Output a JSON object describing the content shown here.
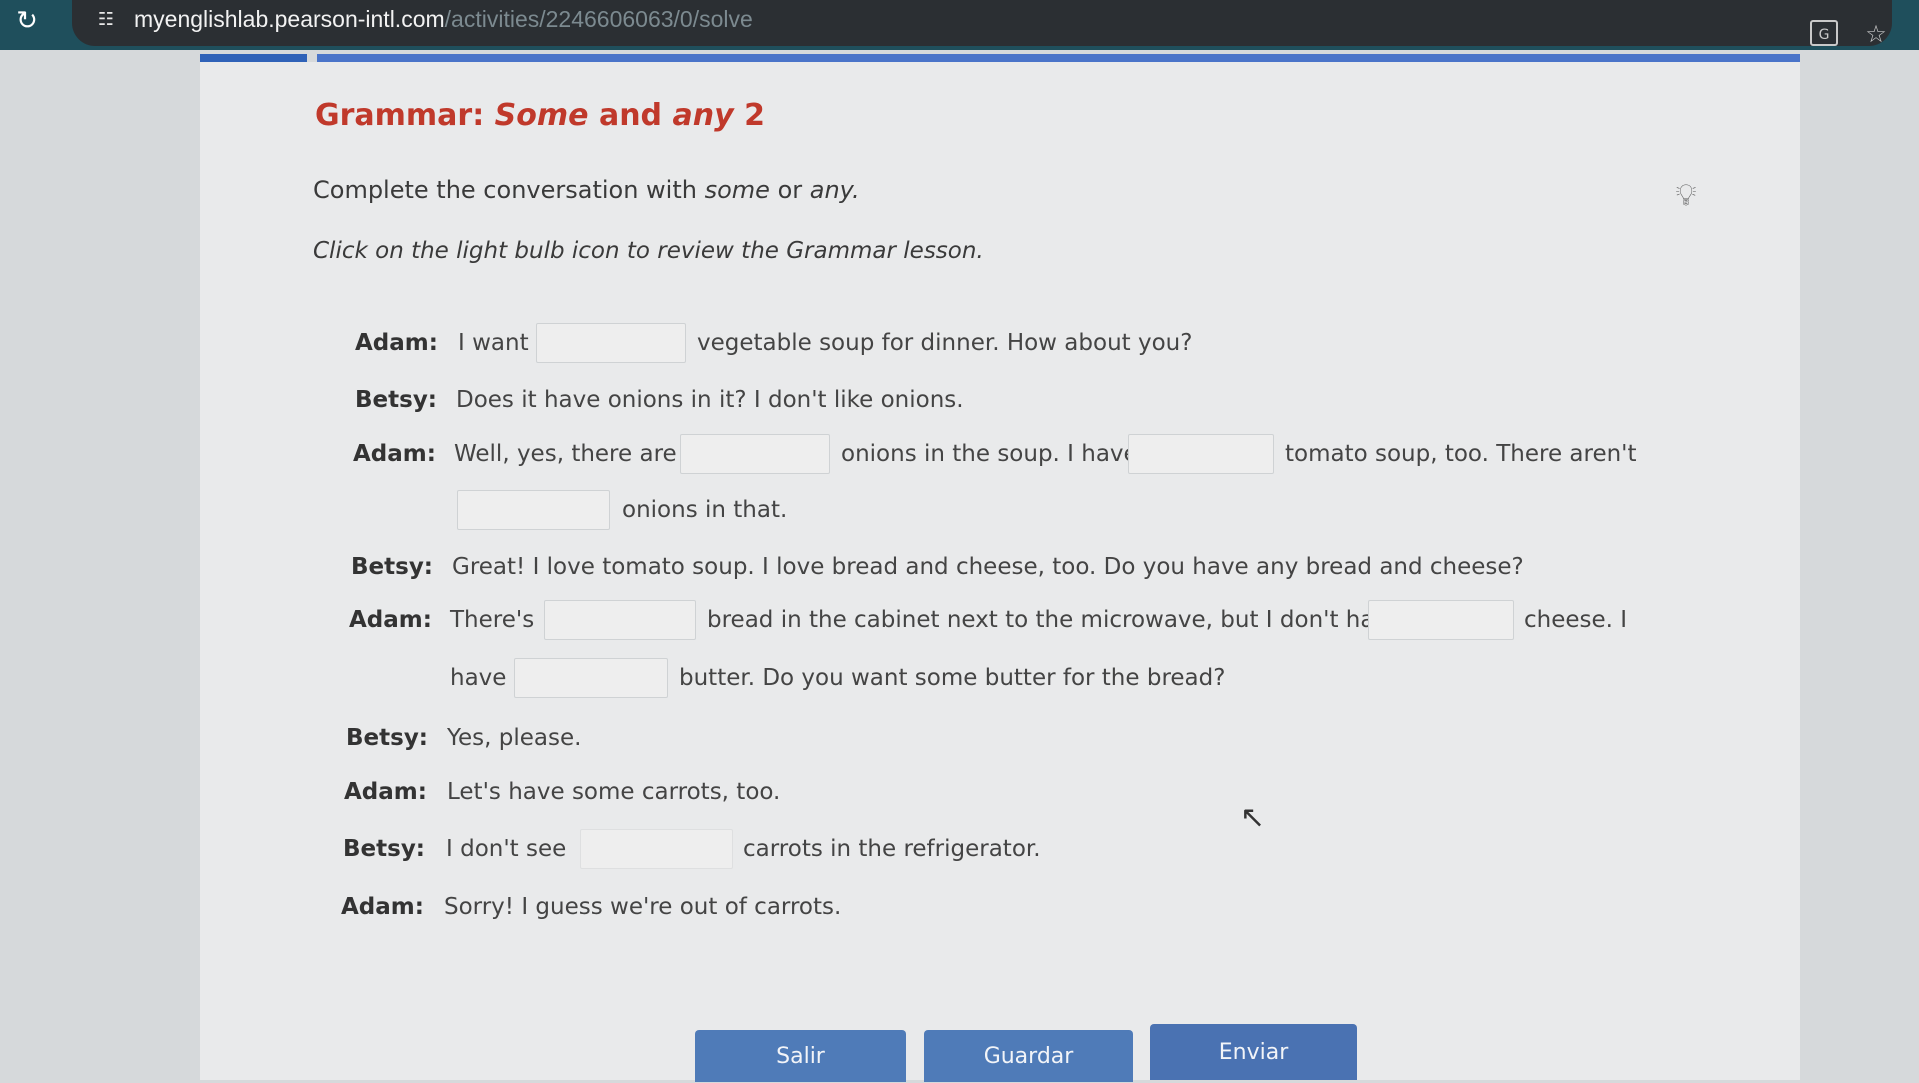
{
  "browser": {
    "url_host": "myenglishlab.pearson-intl.com",
    "url_path": "/activities/2246606063/0/solve"
  },
  "activity": {
    "title_prefix": "Grammar: ",
    "title_some": "Some",
    "title_and": " and ",
    "title_any": "any",
    "title_suffix": " 2",
    "instruction_prefix": "Complete the conversation with ",
    "instruction_some": "some",
    "instruction_or": " or ",
    "instruction_any": "any.",
    "hint": "Click on the light bulb icon to review the Grammar lesson."
  },
  "conversation": {
    "adam": "Adam:",
    "betsy": "Betsy:",
    "l1_a": "I want",
    "l1_b": "vegetable soup for dinner. How about you?",
    "l2": "Does it have onions in it? I don't like onions.",
    "l3_a": "Well, yes, there are",
    "l3_b": "onions in the soup. I have",
    "l3_c": "tomato soup, too. There aren't",
    "l4": "onions in that.",
    "l5": "Great! I love tomato soup. I love bread and cheese, too. Do you have any bread and cheese?",
    "l6_a": "There's",
    "l6_b": "bread in the cabinet next to the microwave, but I don't have",
    "l6_c": "cheese. I",
    "l7_a": "have",
    "l7_b": "butter. Do you want some butter for the bread?",
    "l8": "Yes, please.",
    "l9": "Let's have some carrots, too.",
    "l10_a": "I don't see",
    "l10_b": "carrots in the refrigerator.",
    "l11": "Sorry! I guess we're out of carrots."
  },
  "blanks": [
    "",
    "",
    "",
    "",
    "",
    "",
    "",
    ""
  ],
  "buttons": {
    "exit": "Salir",
    "save": "Guardar",
    "submit": "Enviar"
  },
  "icons": {
    "reload": "reload-icon",
    "site_settings": "site-settings-icon",
    "translate": "translate-icon",
    "bookmark": "star-icon",
    "lightbulb": "lightbulb-icon",
    "cursor": "mouse-cursor-icon"
  }
}
